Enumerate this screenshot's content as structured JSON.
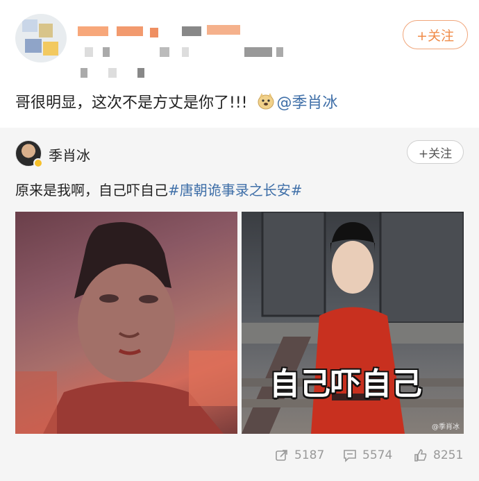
{
  "post": {
    "follow_label": "+关注",
    "text": "哥很明显，这次不是方丈是你了!!!",
    "mention": "@季肖冰"
  },
  "repost": {
    "author": "季肖冰",
    "follow_label": "+关注",
    "text": "原来是我啊，自己吓自己",
    "hashtag": "#唐朝诡事录之长安#",
    "image_caption": "自己吓自己",
    "watermark": "@季肖冰",
    "stats": {
      "reposts": "5187",
      "comments": "5574",
      "likes": "8251"
    }
  },
  "icons": [
    "repost-icon",
    "comment-icon",
    "like-icon",
    "doge-emoji-icon"
  ],
  "colors": {
    "accent": "#f08b48",
    "link": "#3f6fa8",
    "repost_bg": "#f5f5f5"
  }
}
